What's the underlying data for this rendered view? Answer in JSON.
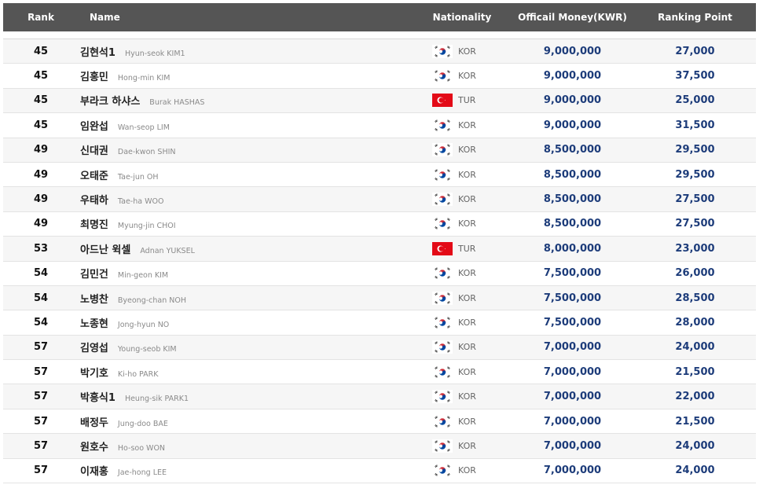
{
  "header": {
    "rank": "Rank",
    "name": "Name",
    "nationality": "Nationality",
    "money": "Officail Money(KWR)",
    "point": "Ranking Point"
  },
  "rows": [
    {
      "rank": "45",
      "kname": "김현석1",
      "ename": "Hyun-seok KIM1",
      "nat": "KOR",
      "flag": "kor-flag-icon",
      "money": "9,000,000",
      "point": "27,000"
    },
    {
      "rank": "45",
      "kname": "김홍민",
      "ename": "Hong-min KIM",
      "nat": "KOR",
      "flag": "kor-flag-icon",
      "money": "9,000,000",
      "point": "37,500"
    },
    {
      "rank": "45",
      "kname": "부라크 하샤스",
      "ename": "Burak HASHAS",
      "nat": "TUR",
      "flag": "tur-flag-icon",
      "money": "9,000,000",
      "point": "25,000"
    },
    {
      "rank": "45",
      "kname": "임완섭",
      "ename": "Wan-seop LIM",
      "nat": "KOR",
      "flag": "kor-flag-icon",
      "money": "9,000,000",
      "point": "31,500"
    },
    {
      "rank": "49",
      "kname": "신대권",
      "ename": "Dae-kwon SHIN",
      "nat": "KOR",
      "flag": "kor-flag-icon",
      "money": "8,500,000",
      "point": "29,500"
    },
    {
      "rank": "49",
      "kname": "오태준",
      "ename": "Tae-jun OH",
      "nat": "KOR",
      "flag": "kor-flag-icon",
      "money": "8,500,000",
      "point": "29,500"
    },
    {
      "rank": "49",
      "kname": "우태하",
      "ename": "Tae-ha WOO",
      "nat": "KOR",
      "flag": "kor-flag-icon",
      "money": "8,500,000",
      "point": "27,500"
    },
    {
      "rank": "49",
      "kname": "최명진",
      "ename": "Myung-jin CHOI",
      "nat": "KOR",
      "flag": "kor-flag-icon",
      "money": "8,500,000",
      "point": "27,500"
    },
    {
      "rank": "53",
      "kname": "아드난 윅셀",
      "ename": "Adnan YUKSEL",
      "nat": "TUR",
      "flag": "tur-flag-icon",
      "money": "8,000,000",
      "point": "23,000"
    },
    {
      "rank": "54",
      "kname": "김민건",
      "ename": "Min-geon KIM",
      "nat": "KOR",
      "flag": "kor-flag-icon",
      "money": "7,500,000",
      "point": "26,000"
    },
    {
      "rank": "54",
      "kname": "노병찬",
      "ename": "Byeong-chan NOH",
      "nat": "KOR",
      "flag": "kor-flag-icon",
      "money": "7,500,000",
      "point": "28,500"
    },
    {
      "rank": "54",
      "kname": "노종현",
      "ename": "Jong-hyun NO",
      "nat": "KOR",
      "flag": "kor-flag-icon",
      "money": "7,500,000",
      "point": "28,000"
    },
    {
      "rank": "57",
      "kname": "김영섭",
      "ename": "Young-seob KIM",
      "nat": "KOR",
      "flag": "kor-flag-icon",
      "money": "7,000,000",
      "point": "24,000"
    },
    {
      "rank": "57",
      "kname": "박기호",
      "ename": "Ki-ho PARK",
      "nat": "KOR",
      "flag": "kor-flag-icon",
      "money": "7,000,000",
      "point": "21,500"
    },
    {
      "rank": "57",
      "kname": "박흥식1",
      "ename": "Heung-sik PARK1",
      "nat": "KOR",
      "flag": "kor-flag-icon",
      "money": "7,000,000",
      "point": "22,000"
    },
    {
      "rank": "57",
      "kname": "배정두",
      "ename": "Jung-doo BAE",
      "nat": "KOR",
      "flag": "kor-flag-icon",
      "money": "7,000,000",
      "point": "21,500"
    },
    {
      "rank": "57",
      "kname": "원호수",
      "ename": "Ho-soo WON",
      "nat": "KOR",
      "flag": "kor-flag-icon",
      "money": "7,000,000",
      "point": "24,000"
    },
    {
      "rank": "57",
      "kname": "이재홍",
      "ename": "Jae-hong LEE",
      "nat": "KOR",
      "flag": "kor-flag-icon",
      "money": "7,000,000",
      "point": "24,000"
    }
  ],
  "colors": {
    "header_bg": "#555555",
    "value_blue": "#1d3c7a",
    "row_alt": "#f6f6f6",
    "tur_red": "#e30a17"
  }
}
